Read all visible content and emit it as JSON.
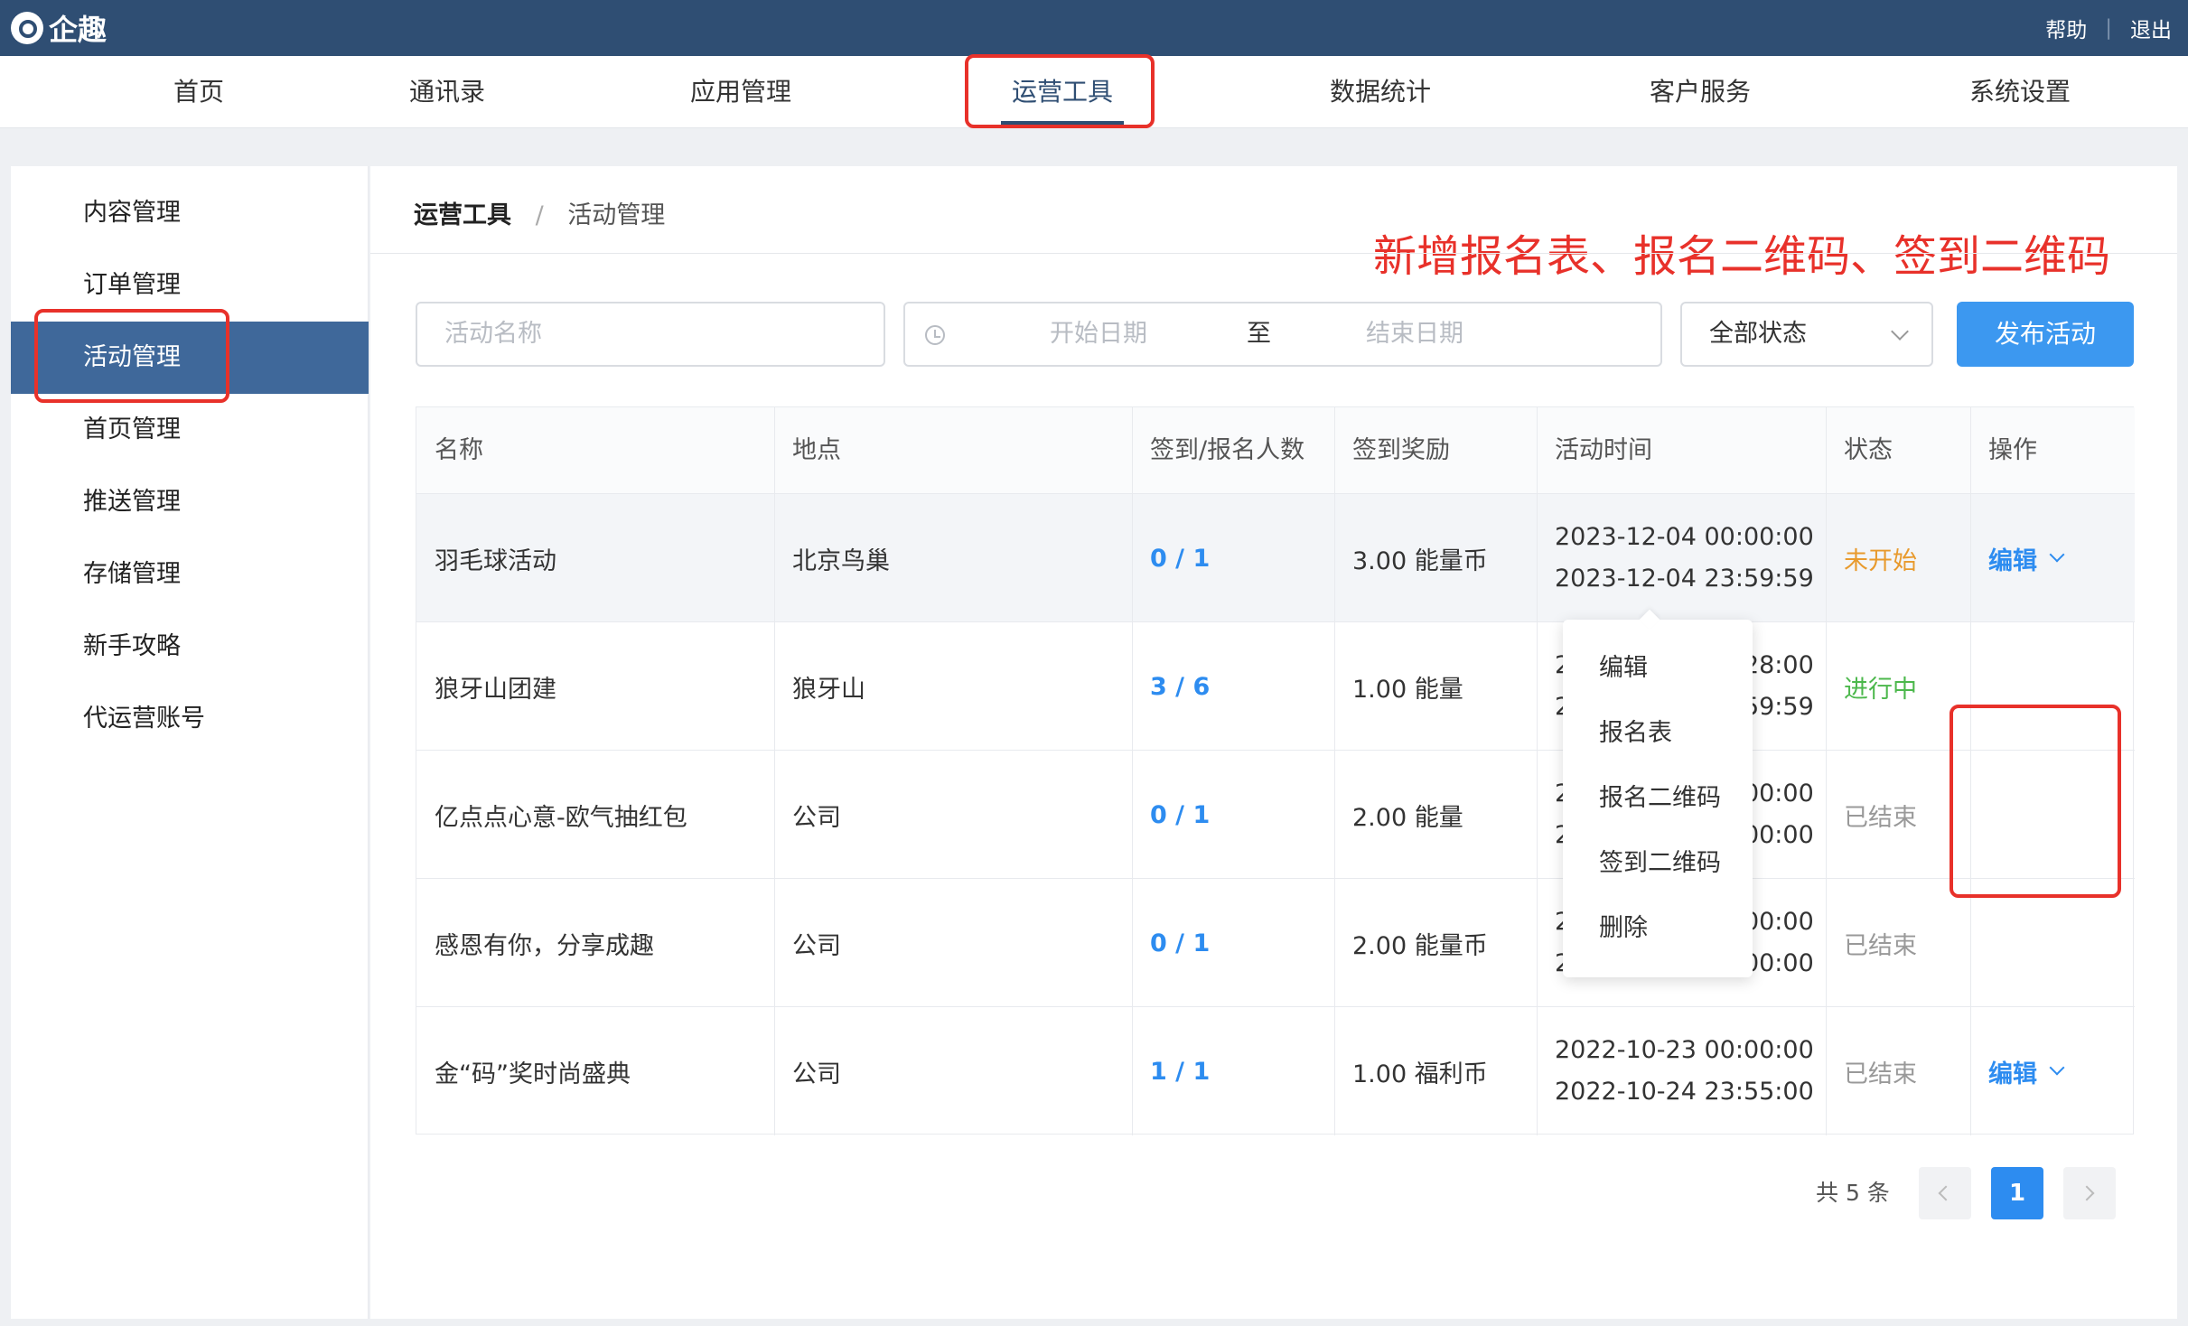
{
  "app": {
    "name": "企趣"
  },
  "top_links": {
    "help": "帮助",
    "sep": "|",
    "logout": "退出"
  },
  "nav": [
    {
      "label": "首页"
    },
    {
      "label": "通讯录"
    },
    {
      "label": "应用管理"
    },
    {
      "label": "运营工具",
      "active": true
    },
    {
      "label": "数据统计"
    },
    {
      "label": "客户服务"
    },
    {
      "label": "系统设置"
    }
  ],
  "sidebar": [
    {
      "label": "内容管理"
    },
    {
      "label": "订单管理"
    },
    {
      "label": "活动管理",
      "active": true
    },
    {
      "label": "首页管理"
    },
    {
      "label": "推送管理"
    },
    {
      "label": "存储管理"
    },
    {
      "label": "新手攻略"
    },
    {
      "label": "代运营账号"
    }
  ],
  "breadcrumb": {
    "root": "运营工具",
    "sep": "/",
    "current": "活动管理"
  },
  "annotation": "新增报名表、报名二维码、签到二维码",
  "filters": {
    "name_placeholder": "活动名称",
    "start_placeholder": "开始日期",
    "to": "至",
    "end_placeholder": "结束日期",
    "status_value": "全部状态"
  },
  "publish_button": "发布活动",
  "table": {
    "headers": [
      "名称",
      "地点",
      "签到/报名人数",
      "签到奖励",
      "活动时间",
      "状态",
      "操作"
    ],
    "rows": [
      {
        "name": "羽毛球活动",
        "place": "北京鸟巢",
        "count": "0 / 1",
        "reward": "3.00 能量币",
        "start": "2023-12-04 00:00:00",
        "end": "2023-12-04 23:59:59",
        "status": "未开始",
        "op": "编辑"
      },
      {
        "name": "狼牙山团建",
        "place": "狼牙山",
        "count": "3 / 6",
        "reward": "1.00 能量",
        "start": "2023-11-30 10:28:00",
        "end": "2023-12-04 23:59:59",
        "status": "进行中",
        "op": ""
      },
      {
        "name": "亿点点心意-欧气抽红包",
        "place": "公司",
        "count": "0 / 1",
        "reward": "2.00 能量",
        "start": "2022-11-04 00:00:00",
        "end": "2022-11-25 00:00:00",
        "status": "已结束",
        "op": ""
      },
      {
        "name": "感恩有你，分享成趣",
        "place": "公司",
        "count": "0 / 1",
        "reward": "2.00 能量币",
        "start": "2022-11-04 00:00:00",
        "end": "2022-11-25 00:00:00",
        "status": "已结束",
        "op": ""
      },
      {
        "name": "金“码”奖时尚盛典",
        "place": "公司",
        "count": "1 / 1",
        "reward": "1.00 福利币",
        "start": "2022-10-23 00:00:00",
        "end": "2022-10-24 23:55:00",
        "status": "已结束",
        "op": "编辑"
      }
    ]
  },
  "dropdown": [
    "编辑",
    "报名表",
    "报名二维码",
    "签到二维码",
    "删除"
  ],
  "pagination": {
    "total": "共 5 条",
    "current": "1"
  },
  "colors": {
    "topbar": "#2f4e73",
    "accent": "#2d8cf0",
    "highlight": "#e8312a"
  }
}
